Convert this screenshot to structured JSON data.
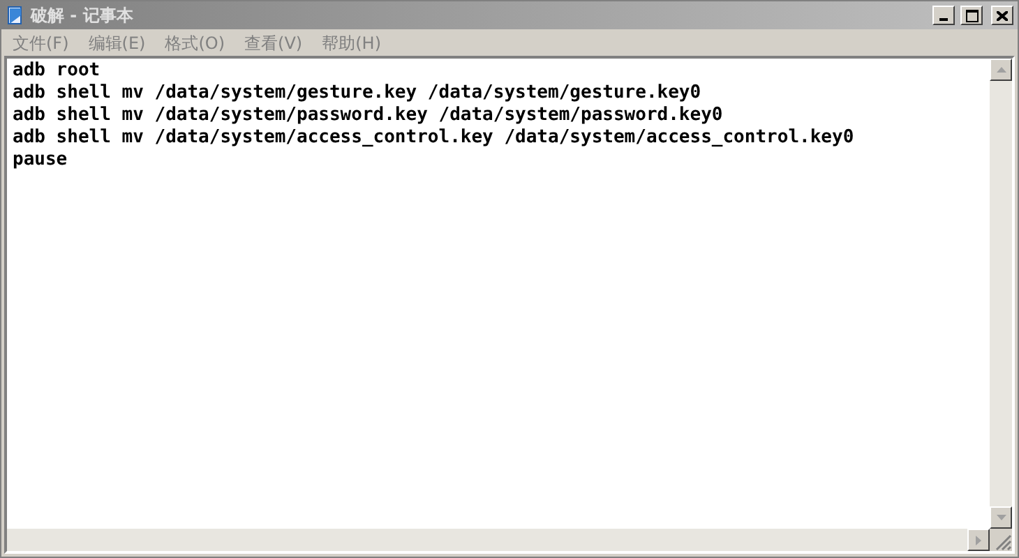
{
  "window": {
    "title": "破解 - 记事本"
  },
  "menu": [
    {
      "label": "文件(F)"
    },
    {
      "label": "编辑(E)"
    },
    {
      "label": "格式(O)"
    },
    {
      "label": "查看(V)"
    },
    {
      "label": "帮助(H)"
    }
  ],
  "editor": {
    "lines": [
      "adb root",
      "adb shell mv /data/system/gesture.key /data/system/gesture.key0",
      "adb shell mv /data/system/password.key /data/system/password.key0",
      "adb shell mv /data/system/access_control.key /data/system/access_control.key0",
      "pause"
    ]
  }
}
